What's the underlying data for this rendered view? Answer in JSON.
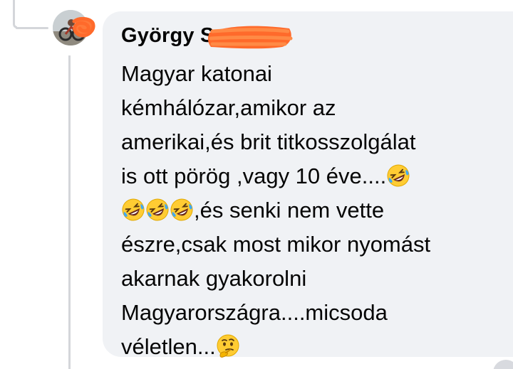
{
  "comment": {
    "author": "György S",
    "lines": [
      {
        "segments": [
          {
            "text": "Magyar katonai"
          }
        ]
      },
      {
        "segments": [
          {
            "text": "kémhálózar,amikor az"
          }
        ]
      },
      {
        "segments": [
          {
            "text": "amerikai,és brit titkosszolgálat"
          }
        ]
      },
      {
        "segments": [
          {
            "text": "is ott pörög ,vagy 10 éve...."
          },
          {
            "emoji": "rolling-on-floor-laughing-emoji"
          }
        ]
      },
      {
        "segments": [
          {
            "emoji": "rolling-on-floor-laughing-emoji"
          },
          {
            "emoji": "rolling-on-floor-laughing-emoji"
          },
          {
            "emoji": "rolling-on-floor-laughing-emoji"
          },
          {
            "text": ",és senki nem vette"
          }
        ]
      },
      {
        "segments": [
          {
            "text": "észre,csak most mikor nyomást"
          }
        ]
      },
      {
        "segments": [
          {
            "text": "akarnak gyakorolni"
          }
        ]
      },
      {
        "segments": [
          {
            "text": "Magyarországra....micsoda"
          }
        ]
      },
      {
        "segments": [
          {
            "text": "véletlen..."
          },
          {
            "emoji": "thinking-face-emoji"
          }
        ]
      }
    ]
  },
  "colors": {
    "bubble_bg": "#f0f2f5",
    "text": "#050505",
    "thread_line": "#d4d6da",
    "redaction": "#ff6a2b"
  }
}
